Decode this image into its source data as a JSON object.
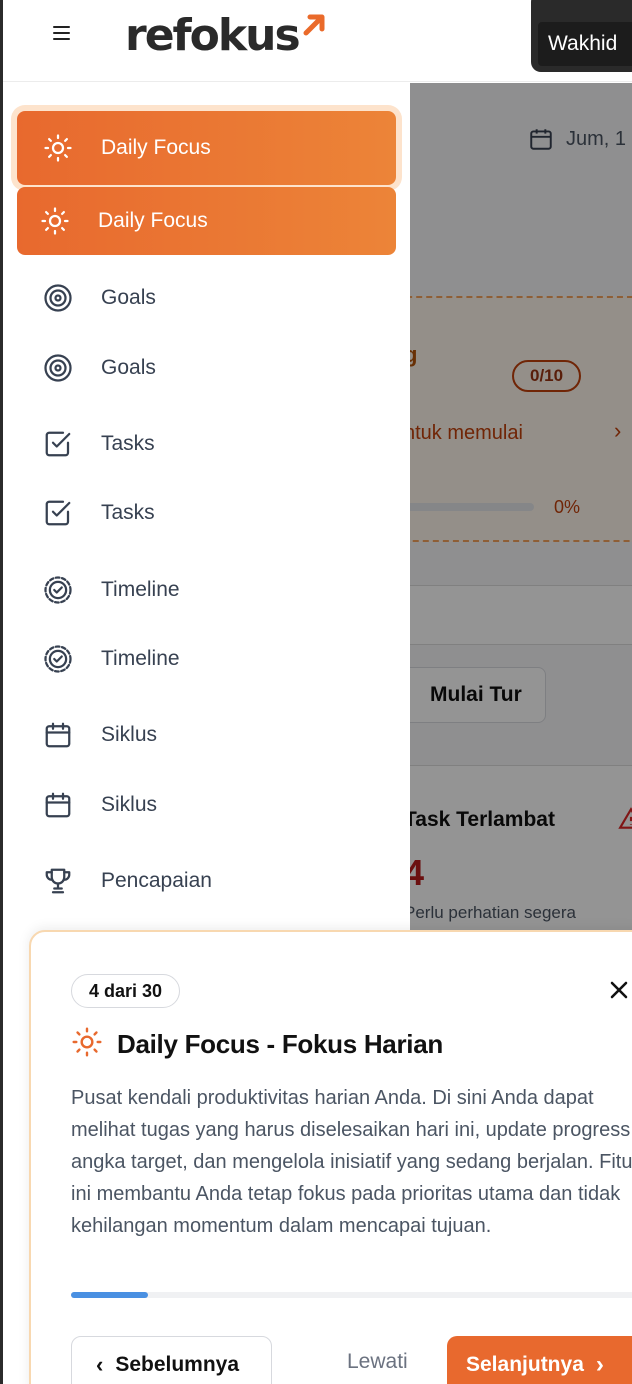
{
  "header": {
    "logo_text": "refokus",
    "user_name": "Wakhid"
  },
  "background": {
    "date_text": "Jum, 1",
    "card": {
      "title_fragment": "g",
      "badge": "0/10",
      "hint": "ntuk memulai",
      "percent": "0%",
      "progress": 0
    },
    "tour_button": "Mulai Tur",
    "stat": {
      "title": "Task Terlambat",
      "value": "4",
      "subtitle": "Perlu perhatian segera"
    }
  },
  "sidebar": {
    "items": [
      {
        "label": "Daily Focus",
        "icon": "sun-icon",
        "active": true
      },
      {
        "label": "Daily Focus",
        "icon": "sun-icon",
        "active": true
      },
      {
        "label": "Goals",
        "icon": "target-icon"
      },
      {
        "label": "Goals",
        "icon": "target-icon"
      },
      {
        "label": "Tasks",
        "icon": "checkbox-icon"
      },
      {
        "label": "Tasks",
        "icon": "checkbox-icon"
      },
      {
        "label": "Timeline",
        "icon": "badge-check-icon"
      },
      {
        "label": "Timeline",
        "icon": "badge-check-icon"
      },
      {
        "label": "Siklus",
        "icon": "calendar-icon"
      },
      {
        "label": "Siklus",
        "icon": "calendar-icon"
      },
      {
        "label": "Pencapaian",
        "icon": "trophy-icon"
      }
    ]
  },
  "tour": {
    "step_label": "4 dari 30",
    "title": "Daily Focus - Fokus Harian",
    "description": "Pusat kendali produktivitas harian Anda. Di sini Anda dapat melihat tugas yang harus diselesaikan hari ini, update progress angka target, dan mengelola inisiatif yang sedang berjalan. Fitur ini membantu Anda tetap fokus pada prioritas utama dan tidak kehilangan momentum dalam mencapai tujuan.",
    "progress": 0.133,
    "prev_label": "Sebelumnya",
    "skip_label": "Lewati",
    "next_label": "Selanjutnya"
  },
  "colors": {
    "accent": "#e8692e",
    "progress_blue": "#4a90e2"
  }
}
